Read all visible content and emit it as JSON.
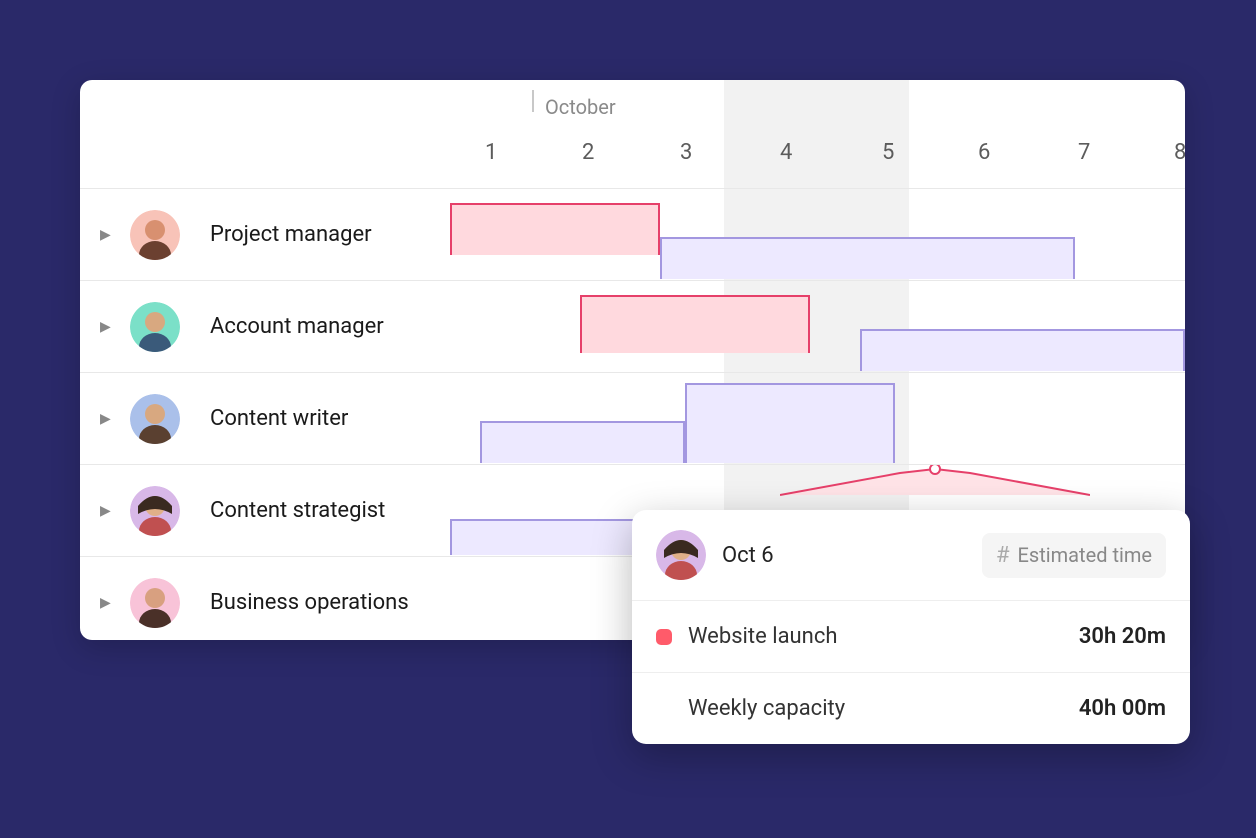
{
  "timeline": {
    "month": "October",
    "days": [
      "1",
      "2",
      "3",
      "4",
      "5",
      "6",
      "7",
      "8"
    ]
  },
  "roles": [
    {
      "name": "Project manager",
      "avatar_bg": "#f8c3b8"
    },
    {
      "name": "Account manager",
      "avatar_bg": "#7be0c8"
    },
    {
      "name": "Content writer",
      "avatar_bg": "#aac0ea"
    },
    {
      "name": "Content strategist",
      "avatar_bg": "#d8b8e8"
    },
    {
      "name": "Business operations",
      "avatar_bg": "#f8c3d8"
    }
  ],
  "popup": {
    "date": "Oct 6",
    "estimated_label": "Estimated time",
    "items": [
      {
        "label": "Website launch",
        "value": "30h 20m",
        "color": "red"
      },
      {
        "label": "Weekly capacity",
        "value": "40h 00m",
        "color": "none"
      }
    ]
  },
  "chart_data": {
    "type": "bar",
    "title": "",
    "xlabel": "",
    "ylabel": "",
    "categories": [
      "1",
      "2",
      "3",
      "4",
      "5",
      "6",
      "7",
      "8"
    ],
    "note": "Gantt-style workload bars; horizontal bars per role spanning day-ranges at high/low levels",
    "series": [
      {
        "name": "Project manager / pink",
        "start": 1,
        "end": 3,
        "level": "high",
        "color": "#e6406a"
      },
      {
        "name": "Project manager / purple",
        "start": 3,
        "end": 7,
        "level": "low",
        "color": "#a397e0"
      },
      {
        "name": "Account manager / pink",
        "start": 2,
        "end": 4,
        "level": "high",
        "color": "#e6406a"
      },
      {
        "name": "Account manager / purple",
        "start": 4.5,
        "end": 8,
        "level": "low",
        "color": "#a397e0"
      },
      {
        "name": "Content writer / purple low",
        "start": 1,
        "end": 3,
        "level": "low",
        "color": "#a397e0"
      },
      {
        "name": "Content writer / purple high",
        "start": 3,
        "end": 5,
        "level": "high",
        "color": "#a397e0"
      },
      {
        "name": "Content strategist / purple",
        "start": 1,
        "end": 3,
        "level": "low",
        "color": "#a397e0"
      },
      {
        "name": "Content strategist / pink spike",
        "start": 4,
        "end": 7,
        "level": "peak",
        "color": "#e6406a"
      }
    ]
  }
}
